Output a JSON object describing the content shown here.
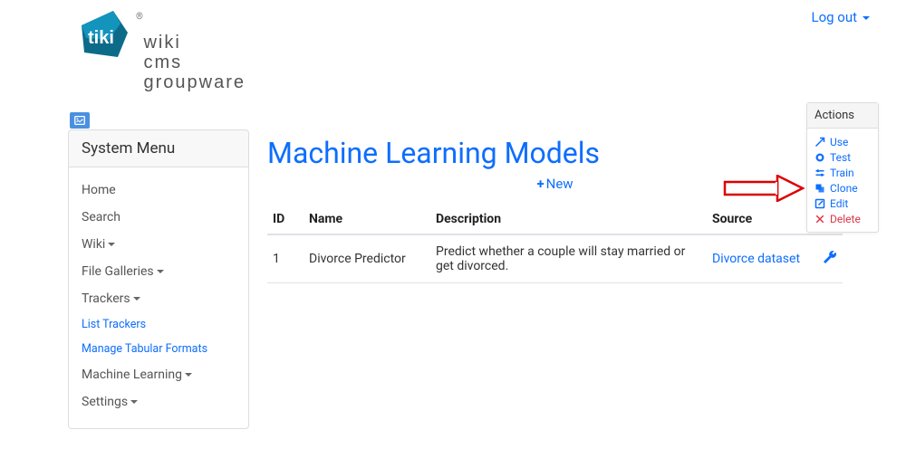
{
  "header": {
    "logout_label": "Log out"
  },
  "logo": {
    "line1": "wiki",
    "line2": "cms",
    "line3": "groupware"
  },
  "sidebar": {
    "title": "System Menu",
    "items": [
      {
        "label": "Home",
        "expandable": false,
        "sub": false
      },
      {
        "label": "Search",
        "expandable": false,
        "sub": false
      },
      {
        "label": "Wiki",
        "expandable": true,
        "sub": false
      },
      {
        "label": "File Galleries",
        "expandable": true,
        "sub": false
      },
      {
        "label": "Trackers",
        "expandable": true,
        "sub": false
      },
      {
        "label": "List Trackers",
        "expandable": false,
        "sub": true
      },
      {
        "label": "Manage Tabular Formats",
        "expandable": false,
        "sub": true
      },
      {
        "label": "Machine Learning",
        "expandable": true,
        "sub": false
      },
      {
        "label": "Settings",
        "expandable": true,
        "sub": false
      }
    ]
  },
  "page": {
    "title": "Machine Learning Models",
    "new_label": "New",
    "columns": {
      "id": "ID",
      "name": "Name",
      "description": "Description",
      "source": "Source"
    },
    "rows": [
      {
        "id": "1",
        "name": "Divorce Predictor",
        "description": "Predict whether a couple will stay married or get divorced.",
        "source": "Divorce dataset"
      }
    ]
  },
  "actions": {
    "title": "Actions",
    "items": [
      {
        "key": "use",
        "label": "Use",
        "color": "blue"
      },
      {
        "key": "test",
        "label": "Test",
        "color": "blue"
      },
      {
        "key": "train",
        "label": "Train",
        "color": "blue"
      },
      {
        "key": "clone",
        "label": "Clone",
        "color": "blue"
      },
      {
        "key": "edit",
        "label": "Edit",
        "color": "blue"
      },
      {
        "key": "delete",
        "label": "Delete",
        "color": "red"
      }
    ]
  }
}
